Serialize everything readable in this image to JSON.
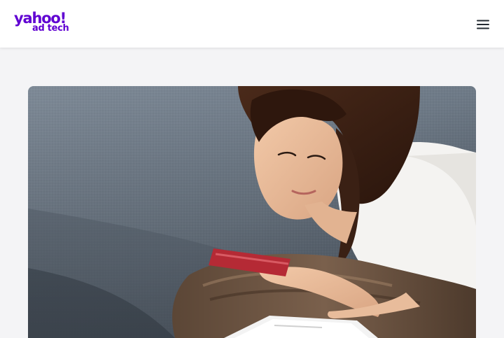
{
  "brand": {
    "logo_text": "yahoo!",
    "logo_subtext": "ad tech",
    "color": "#6001d2"
  },
  "header": {
    "menu_icon": "hamburger-menu-icon"
  },
  "hero": {
    "image_subject": "woman-holding-credit-card-using-tablet-on-sofa"
  },
  "colors": {
    "background": "#f4f4f6",
    "header_bg": "#ffffff",
    "icon": "#232a31"
  }
}
